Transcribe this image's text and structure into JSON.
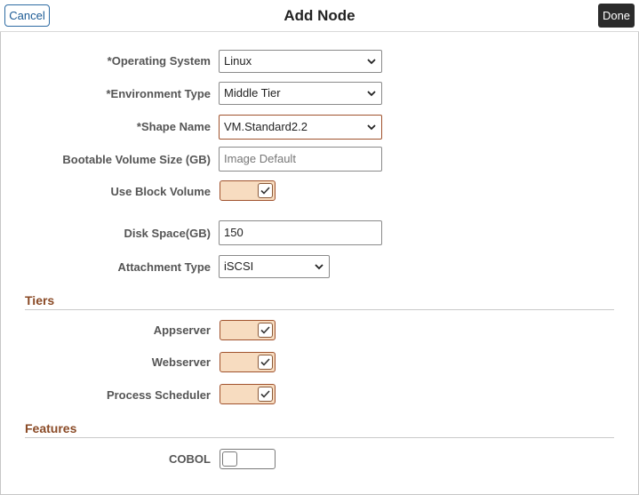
{
  "header": {
    "cancel_label": "Cancel",
    "title": "Add Node",
    "done_label": "Done"
  },
  "form": {
    "operating_system": {
      "label": "*Operating System",
      "value": "Linux"
    },
    "environment_type": {
      "label": "*Environment Type",
      "value": "Middle Tier"
    },
    "shape_name": {
      "label": "*Shape Name",
      "value": "VM.Standard2.2"
    },
    "bootable_volume": {
      "label": "Bootable Volume Size (GB)",
      "placeholder": "Image Default",
      "value": ""
    },
    "use_block_volume": {
      "label": "Use Block Volume",
      "checked": true
    },
    "disk_space": {
      "label": "Disk Space(GB)",
      "value": "150"
    },
    "attachment_type": {
      "label": "Attachment Type",
      "value": "iSCSI"
    }
  },
  "tiers": {
    "title": "Tiers",
    "appserver": {
      "label": "Appserver",
      "checked": true
    },
    "webserver": {
      "label": "Webserver",
      "checked": true
    },
    "process_scheduler": {
      "label": "Process Scheduler",
      "checked": true
    }
  },
  "features": {
    "title": "Features",
    "cobol": {
      "label": "COBOL",
      "checked": false
    }
  },
  "colors": {
    "accent": "#a0522d",
    "toggle_on_bg": "#f7dcc0",
    "section_title": "#8a4a26",
    "link_blue": "#1c5a94"
  }
}
